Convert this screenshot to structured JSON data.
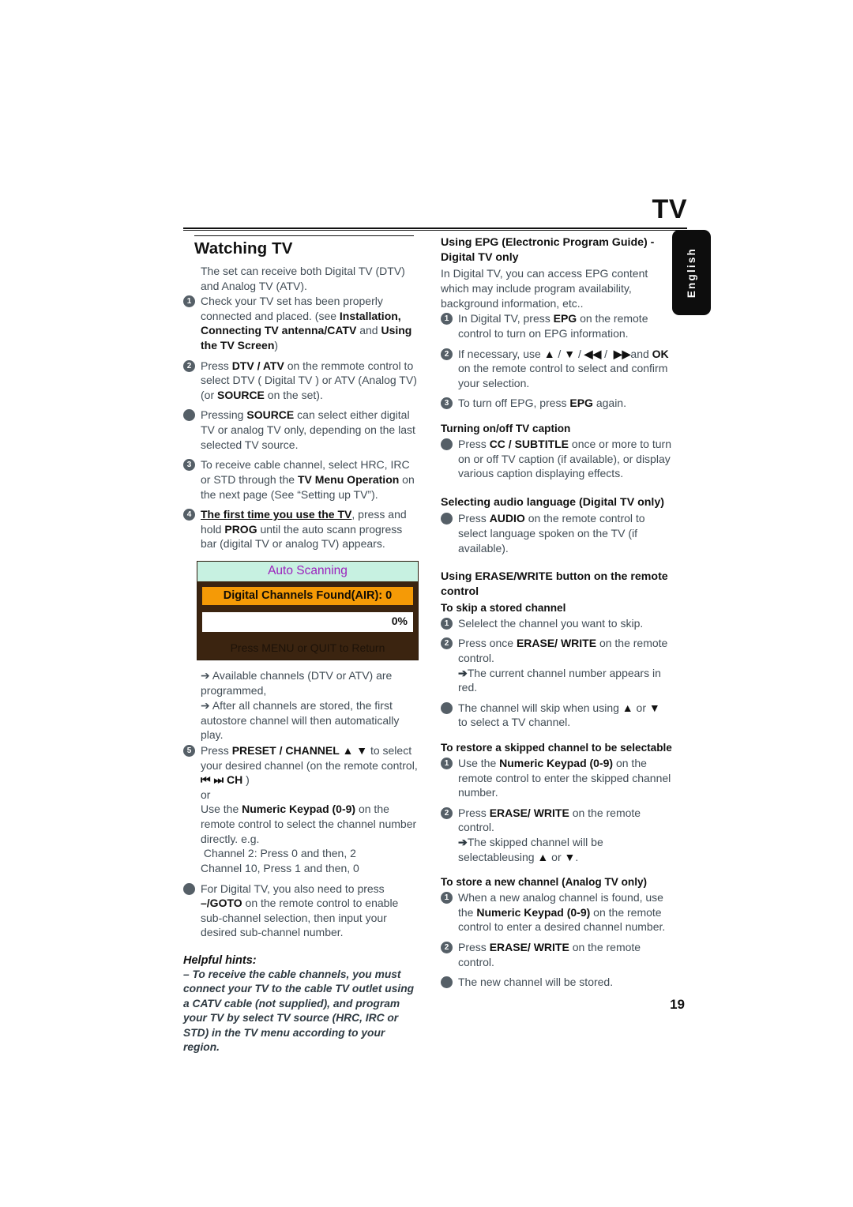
{
  "page": {
    "title": "TV",
    "language_tab": "English",
    "page_number": "19"
  },
  "left_column": {
    "section_title": "Watching TV",
    "intro": "The set can receive both Digital TV (DTV) and Analog TV (ATV).",
    "steps": [
      {
        "marker": "1",
        "type": "number",
        "text_html": "Check your TV set has been properly connected and placed. (see <b>Installation, Connecting TV antenna/CATV</b> and <b>Using the TV Screen</b>)"
      },
      {
        "marker": "2",
        "type": "number",
        "text_html": "Press <b>DTV / ATV</b> on the remmote control to select DTV ( Digital TV ) or ATV (Analog TV) (or <b>SOURCE</b> on the set)."
      },
      {
        "marker": "•",
        "type": "dot",
        "text_html": "Pressing <b>SOURCE</b> can select either digital TV or analog TV only, depending on the last selected TV source."
      },
      {
        "marker": "3",
        "type": "number",
        "text_html": "To receive cable channel, select HRC, IRC or STD through the <b>TV Menu Operation</b> on the next page (See “Setting up TV”)."
      },
      {
        "marker": "4",
        "type": "number",
        "text_html": "<span class=\"u\">The first time you use the TV</span>, press and hold <b>PROG</b> until the auto scann progress bar (digital TV or analog TV) appears."
      }
    ],
    "osd": {
      "header": "Auto Scanning",
      "channels_found": "Digital Channels Found(AIR): 0",
      "progress_percent": "0%",
      "footer": "Press MENU or QUIT to Return",
      "colors": {
        "header_bg": "#c7f1e1",
        "header_text": "#9b22bd",
        "body_bg": "#3b2410",
        "found_bg": "#f59a06",
        "bar_bg": "#ffffff"
      }
    },
    "after_osd": [
      "➔ Available channels (DTV or ATV) are programmed,",
      "➔ After all channels are stored, the first autostore channel will then automatically play."
    ],
    "steps_after": [
      {
        "marker": "5",
        "type": "number",
        "text_html": "Press <b>PRESET / CHANNEL ▲ ▼</b> to select your desired channel (on the remote control, <b>⏮ ⏭ CH</b> )<br>or<br>Use the <b>Numeric Keypad (0-9)</b> on the remote control to select the channel number directly. e.g.<br>&nbsp;Channel 2: Press 0 and then, 2<br>Channel 10, Press 1 and then, 0"
      },
      {
        "marker": "•",
        "type": "dot",
        "text_html": "For Digital TV, you also need to press <b>–/GOTO</b> on the remote control to enable sub-channel selection, then input your desired sub-channel number."
      }
    ],
    "helpful_hints": {
      "title": "Helpful hints:",
      "body": "–  To receive the cable channels, you must connect your TV to the cable TV outlet using a CATV cable (not supplied), and program your TV by select TV source (HRC, IRC or STD) in the TV menu according to your region."
    }
  },
  "right_column": {
    "epg": {
      "heading": "Using EPG (Electronic Program Guide) - Digital TV only",
      "intro": "In Digital TV, you can access EPG content which may include program availability, background information, etc..",
      "steps": [
        {
          "marker": "1",
          "type": "number",
          "text_html": "In Digital TV, press <b>EPG</b> on the remote control to turn on EPG information."
        },
        {
          "marker": "2",
          "type": "number",
          "text_html": "If necessary, use <b>▲</b> / <b>▼</b> / <b>◀◀</b> /&nbsp; <b>▶▶</b>and <b>OK</b> on the remote control to select and confirm your selection."
        },
        {
          "marker": "3",
          "type": "number",
          "text_html": "To turn off EPG, press <b>EPG</b> again."
        }
      ]
    },
    "caption": {
      "heading": "Turning on/off  TV caption",
      "steps": [
        {
          "marker": "•",
          "type": "dot",
          "text_html": "Press <b>CC / SUBTITLE</b> once or more to turn on or off TV caption (if available), or display various caption displaying effects."
        }
      ]
    },
    "audio_language": {
      "heading": "Selecting  audio language (Digital TV only)",
      "steps": [
        {
          "marker": "•",
          "type": "dot",
          "text_html": "Press <b>AUDIO</b> on the remote control to select language spoken on the TV (if available)."
        }
      ]
    },
    "erase_write": {
      "heading": "Using ERASE/WRITE button on the remote control",
      "skip": {
        "subheading": "To skip a stored channel",
        "steps": [
          {
            "marker": "1",
            "type": "number",
            "text_html": "Selelect the channel you want to skip."
          },
          {
            "marker": "2",
            "type": "number",
            "text_html": "Press once <b>ERASE/ WRITE</b> on the remote control.<br><span class=\"arw\">➔</span>The current channel number appears in red."
          },
          {
            "marker": "•",
            "type": "dot",
            "text_html": "The channel will skip when using <b>▲</b> or <b>▼</b>&nbsp; to select a TV channel."
          }
        ]
      },
      "restore": {
        "subheading": "To restore a skipped channel to be selectable",
        "steps": [
          {
            "marker": "1",
            "type": "number",
            "text_html": "Use the  <b>Numeric Keypad (0-9)</b> on the remote control to enter the skipped channel number."
          },
          {
            "marker": "2",
            "type": "number",
            "text_html": "Press <b>ERASE/ WRITE</b> on the remote control.<br><span class=\"arw\">➔</span>The skipped channel will be selectableusing <b>▲</b> or <b>▼</b>."
          }
        ]
      },
      "store": {
        "subheading": "To store a new channel (Analog TV only)",
        "steps": [
          {
            "marker": "1",
            "type": "number",
            "text_html": "When a new analog channel is found, use the <b>Numeric Keypad (0-9)</b> on the remote control to enter a desired channel number."
          },
          {
            "marker": "2",
            "type": "number",
            "text_html": "Press <b>ERASE/ WRITE</b> on the remote control."
          },
          {
            "marker": "•",
            "type": "dot",
            "text_html": "The new channel will be stored."
          }
        ]
      }
    }
  }
}
